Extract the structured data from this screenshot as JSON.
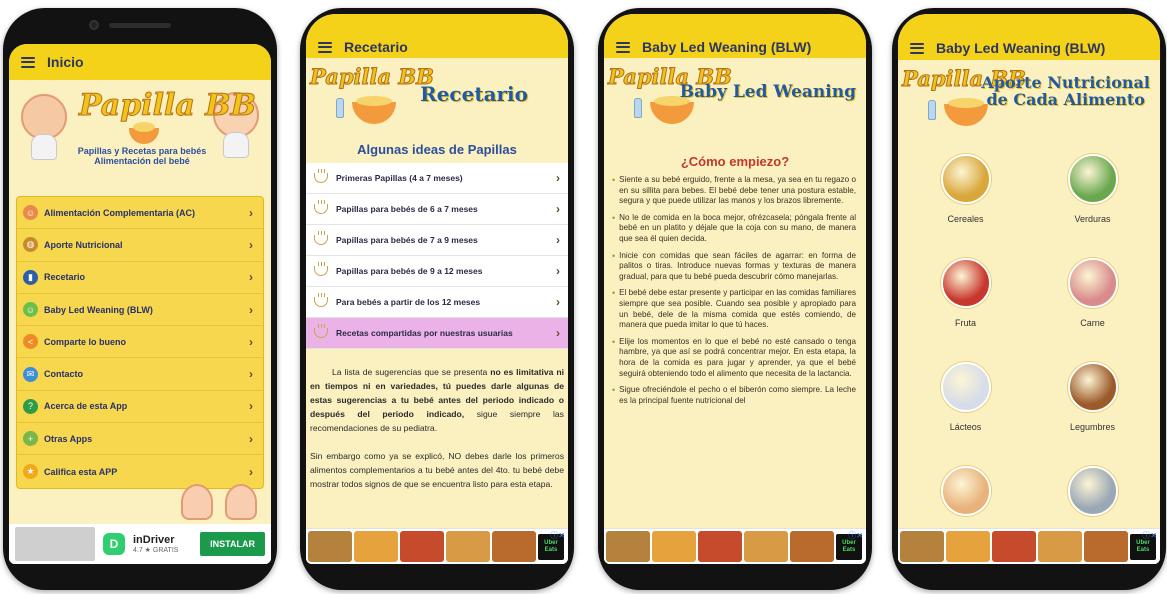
{
  "phone1": {
    "appbar_title": "Inicio",
    "logo_text": "Papilla BB",
    "logo_tagline_1": "Papillas y Recetas para bebés",
    "logo_tagline_2": "Alimentación del bebé",
    "menu": [
      {
        "label": "Alimentación Complementaria (AC)",
        "icon": "baby-food-icon",
        "color": "#e9894a"
      },
      {
        "label": "Aporte Nutricional",
        "icon": "nutrition-bowl-icon",
        "color": "#c98b2a"
      },
      {
        "label": "Recetario",
        "icon": "book-icon",
        "color": "#2f5ea8"
      },
      {
        "label": "Baby Led Weaning (BLW)",
        "icon": "baby-face-icon",
        "color": "#6cc04a"
      },
      {
        "label": "Comparte lo bueno",
        "icon": "share-icon",
        "color": "#f08a24"
      },
      {
        "label": "Contacto",
        "icon": "mail-icon",
        "color": "#3e8fd8"
      },
      {
        "label": "Acerca de esta App",
        "icon": "help-icon",
        "color": "#2e9b45"
      },
      {
        "label": "Otras Apps",
        "icon": "plus-icon",
        "color": "#7ab648"
      },
      {
        "label": "Califica esta APP",
        "icon": "star-icon",
        "color": "#f2a81b"
      }
    ],
    "ad": {
      "app_name": "inDriver",
      "rating": "4.7 ★ GRATIS",
      "button": "INSTALAR"
    }
  },
  "phone2": {
    "appbar_title": "Recetario",
    "logo_text": "Papilla BB",
    "banner_title": "Recetario",
    "subtitle": "Algunas ideas de Papillas",
    "items": [
      {
        "label": "Primeras Papillas (4 a 7 meses)"
      },
      {
        "label": "Papillas para bebés de 6 a 7 meses"
      },
      {
        "label": "Papillas para bebés de 7 a 9 meses"
      },
      {
        "label": "Papillas para bebés de 9 a 12 meses"
      },
      {
        "label": "Para bebés a partir de los 12 meses"
      },
      {
        "label": "Recetas compartidas por nuestras usuarias"
      }
    ],
    "para1_a": "La lista de sugerencias que se presenta ",
    "para1_b": "no es limitativa ni en tiempos ni en variedades, tú puedes darle algunas de estas sugerencias a tu bebé antes del periodo indicado o después del periodo indicado,",
    "para1_c": " sigue siempre las recomendaciones de su pediatra.",
    "para2": "Sin embargo como ya se explicó, NO debes darle los primeros alimentos complementarios a tu bebé antes del 4to. tu bebé debe mostrar todos signos de que se encuentra listo para esta etapa."
  },
  "phone3": {
    "appbar_title": "Baby Led Weaning (BLW)",
    "logo_text": "Papilla BB",
    "banner_title": "Baby Led Weaning",
    "heading": "¿Cómo empiezo?",
    "bullets": [
      "Siente a su bebé erguido, frente a la mesa, ya sea en tu regazo o en su sillita para bebes. El bebé debe tener una postura estable, segura y que puede utilizar las manos y los brazos libremente.",
      "No le de comida en la boca mejor, ofrézcasela; póngala frente al bebé en un platito y déjale que la coja con su mano, de manera que sea él quien decida.",
      "Inicie con comidas que sean fáciles de agarrar: en forma de palitos o tiras. Introduce nuevas formas y texturas de manera gradual, para que tu bebé pueda descubrir cómo manejarlas.",
      "El bebé debe estar presente y participar en las comidas familiares siempre que sea posible. Cuando sea posible y apropiado para un bebé, dele de la misma comida que estés comiendo, de manera que pueda imitar lo que tú haces.",
      "Elije los momentos en lo que el bebé no esté cansado o tenga hambre, ya que así se podrá concentrar mejor. En esta etapa, la hora de la comida es para jugar y aprender, ya que el bebé seguirá obteniendo todo el alimento que necesita de la lactancia.",
      "Sigue ofreciéndole el pecho o el biberón como siempre. La leche es la principal fuente nutricional del"
    ]
  },
  "phone4": {
    "appbar_title": "Baby Led Weaning (BLW)",
    "logo_text": "Papilla BB",
    "banner_title_1": "Aporte Nutricional",
    "banner_title_2": "de Cada Alimento",
    "foods": [
      {
        "label": "Cereales",
        "icon": "cereal-icon",
        "color": "#d9a63a"
      },
      {
        "label": "Verduras",
        "icon": "vegetables-icon",
        "color": "#6aa84f"
      },
      {
        "label": "Fruta",
        "icon": "fruit-icon",
        "color": "#c8372d"
      },
      {
        "label": "Carne",
        "icon": "meat-icon",
        "color": "#d98b8b"
      },
      {
        "label": "Lácteos",
        "icon": "dairy-icon",
        "color": "#d7dde8"
      },
      {
        "label": "Legumbres",
        "icon": "legumes-icon",
        "color": "#9c5a2b"
      },
      {
        "label": "",
        "icon": "eggs-icon",
        "color": "#e8b27a"
      },
      {
        "label": "",
        "icon": "fish-icon",
        "color": "#9aa7b4"
      }
    ]
  },
  "ad_banner": {
    "close": "ⓘ✕",
    "uber_text": "Uber Eats"
  }
}
